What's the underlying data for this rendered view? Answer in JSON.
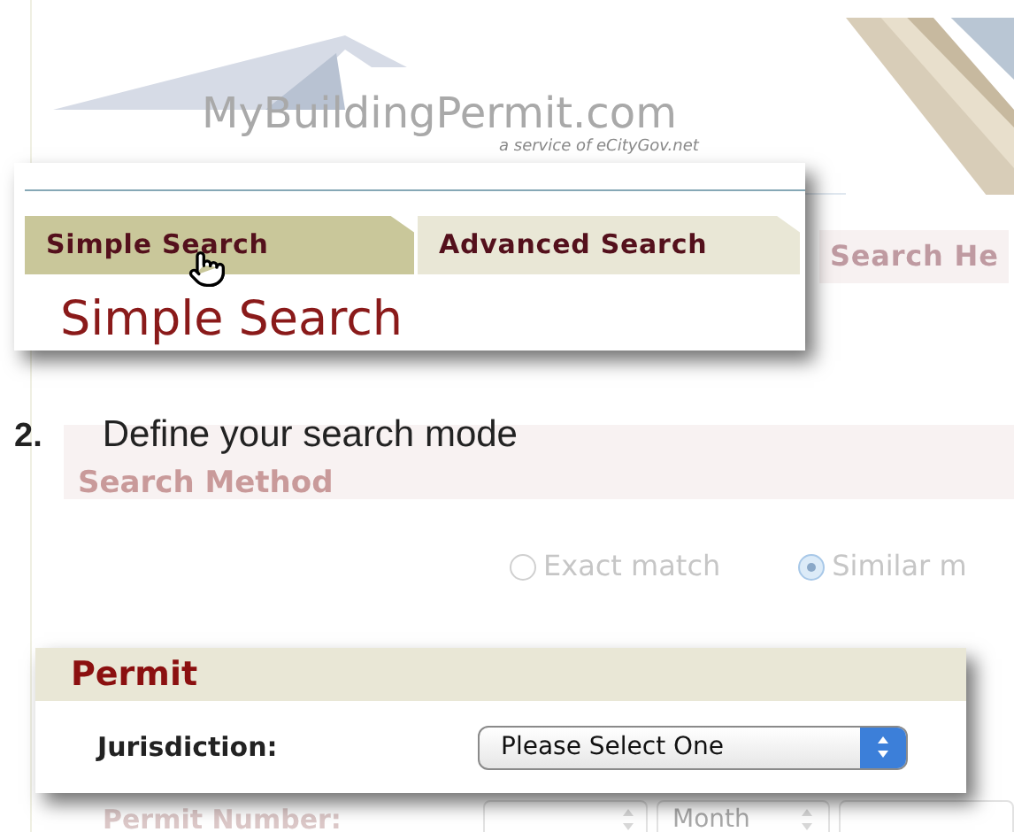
{
  "logo": {
    "name": "MyBuildingPermit.com",
    "tagline": "a service of eCityGov.net"
  },
  "callout_tabs": {
    "tabs": [
      {
        "label": "Simple Search",
        "selected": true
      },
      {
        "label": "Advanced Search",
        "selected": false
      }
    ],
    "heading": "Simple Search"
  },
  "page_tabs": [
    {
      "label": "Search He"
    }
  ],
  "step": {
    "number": "2.",
    "text": "Define your search mode"
  },
  "search_method": {
    "heading": "Search Method",
    "options": [
      {
        "label": "Exact match",
        "selected": false
      },
      {
        "label": "Similar m",
        "selected": true
      }
    ]
  },
  "callout_permit": {
    "heading": "Permit",
    "field": {
      "label": "Jurisdiction:",
      "value": "Please Select One"
    }
  },
  "permit_number": {
    "label": "Permit Number:",
    "month": "Month"
  }
}
